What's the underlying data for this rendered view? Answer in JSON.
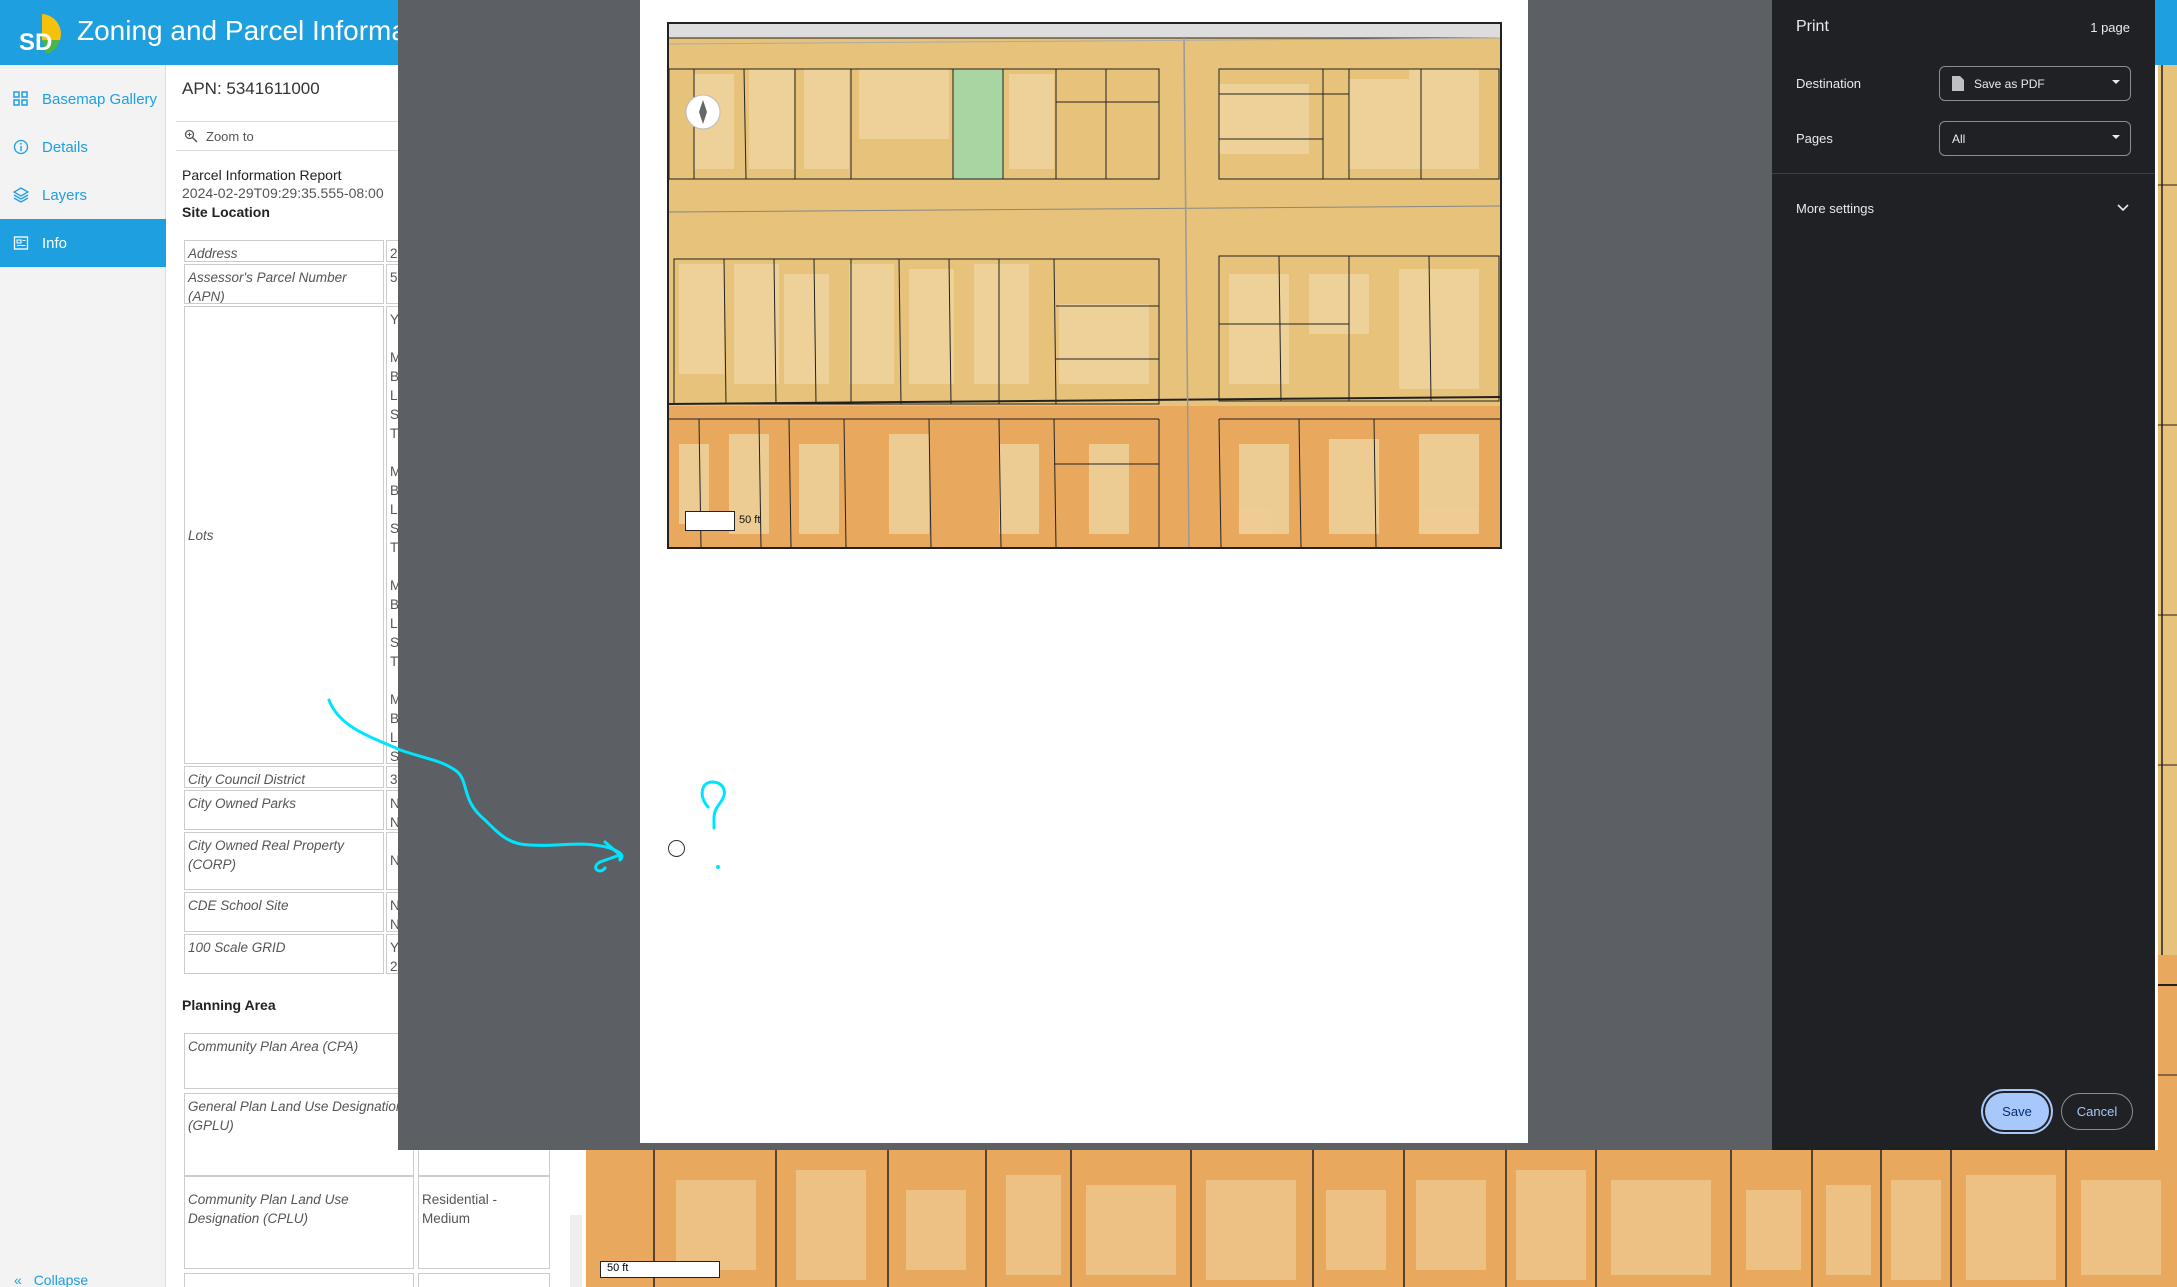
{
  "app": {
    "title": "Zoning and Parcel Information Portal",
    "logo_text": "SD"
  },
  "sidebar": {
    "items": [
      {
        "label": "Basemap Gallery",
        "icon": "grid-icon"
      },
      {
        "label": "Details",
        "icon": "info-icon"
      },
      {
        "label": "Layers",
        "icon": "layers-icon"
      },
      {
        "label": "Info",
        "icon": "document-icon",
        "active": true
      }
    ],
    "collapse_label": "Collapse"
  },
  "panel": {
    "apn": "APN: 5341611000",
    "zoom_label": "Zoom to",
    "report_title": "Parcel Information Report",
    "report_date": "2024-02-29T09:29:35.555-08:00",
    "site_location": "Site Location",
    "rows": [
      {
        "label": "Address",
        "value": "2"
      },
      {
        "label": "Assessor's Parcel Number (APN)",
        "value": "5"
      },
      {
        "label": "Lots",
        "value": "Y\n\nM\nB\nL\nS\nT\n\nM\nB\nL\nS\nT\n\nM\nB\nL\nS\nT\n\nM\nB\nL\nS\nT"
      },
      {
        "label": "City Council District",
        "value": "3"
      },
      {
        "label": "City Owned Parks",
        "value": "N\nN"
      },
      {
        "label": "City Owned Real Property (CORP)",
        "value": "N"
      },
      {
        "label": "CDE School Site",
        "value": "N\nN"
      },
      {
        "label": "100 Scale GRID",
        "value": "Y\n2"
      }
    ],
    "planning_area": "Planning Area",
    "planning_rows": [
      {
        "label": "Community Plan Area (CPA)",
        "value": ""
      },
      {
        "label": "General Plan Land Use Designation (GPLU)",
        "value": ""
      },
      {
        "label": "Community Plan Land Use Designation (CPLU)",
        "value": "Residential - Medium"
      },
      {
        "label": "",
        "value": ""
      }
    ]
  },
  "print": {
    "title": "Print",
    "page_count": "1 page",
    "destination_label": "Destination",
    "destination_value": "Save as PDF",
    "pages_label": "Pages",
    "pages_value": "All",
    "more_settings": "More settings",
    "save": "Save",
    "cancel": "Cancel"
  },
  "preview": {
    "scale_label": "50 ft",
    "annotation": "?"
  },
  "map": {
    "scale_label": "50 ft"
  },
  "colors": {
    "accent": "#1d9fe0",
    "parcel_yellow": "#e6c27a",
    "parcel_orange": "#e8a95f",
    "highlight_parcel": "#a8d5a2",
    "annotation": "#00e5ff"
  }
}
